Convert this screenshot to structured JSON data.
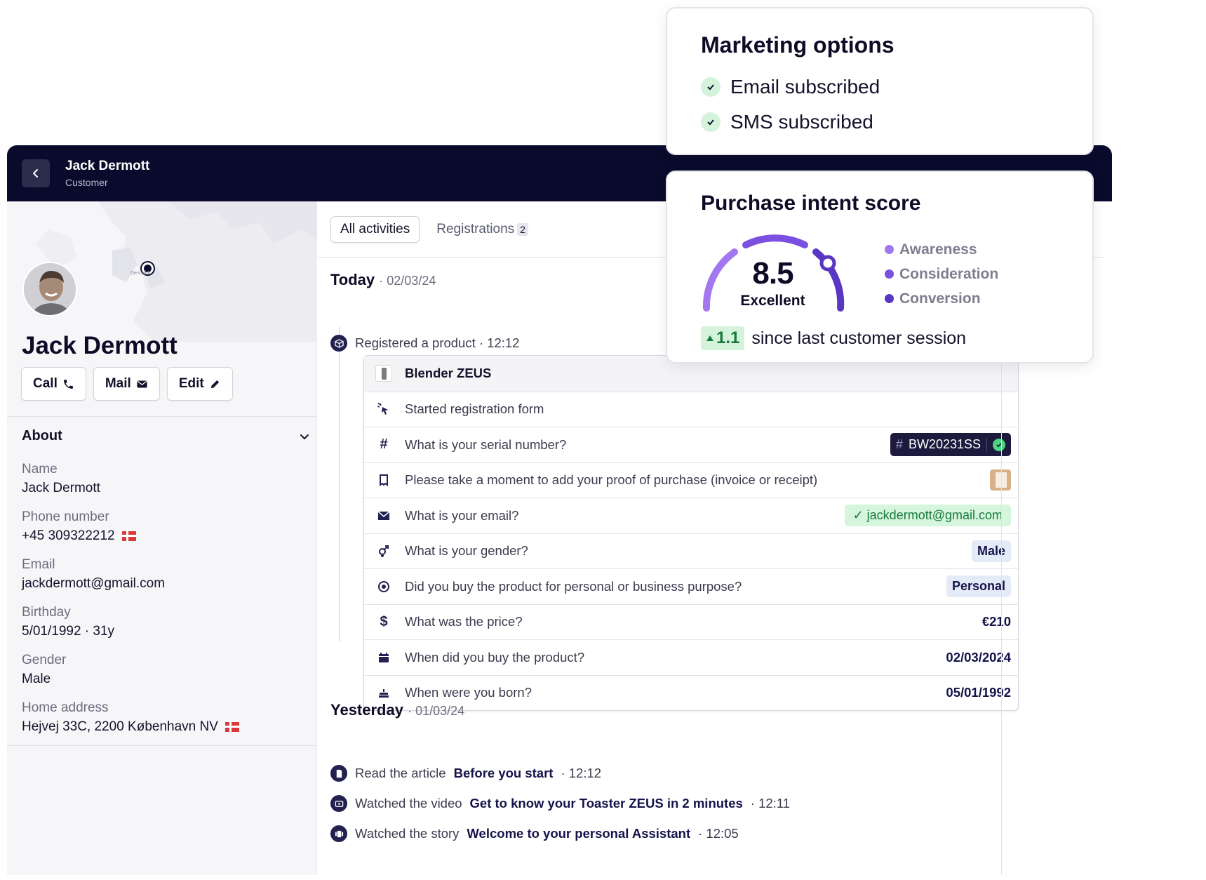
{
  "header": {
    "title": "Jack Dermott",
    "subtitle": "Customer"
  },
  "map": {
    "label": "Denmark"
  },
  "profile": {
    "name": "Jack Dermott",
    "actions": [
      {
        "label": "Call",
        "icon": "phone-icon"
      },
      {
        "label": "Mail",
        "icon": "mail-icon"
      },
      {
        "label": "Edit",
        "icon": "pencil-icon"
      }
    ]
  },
  "about": {
    "title": "About",
    "fields": [
      {
        "label": "Name",
        "value": "Jack Dermott"
      },
      {
        "label": "Phone number",
        "value": "+45 309322212"
      },
      {
        "label": "Email",
        "value": "jackdermott@gmail.com"
      },
      {
        "label": "Birthday",
        "value": "5/01/1992 · 31y"
      },
      {
        "label": "Gender",
        "value": "Male"
      },
      {
        "label": "Home address",
        "value": "Hejvej 33C, 2200 København NV"
      }
    ]
  },
  "tabs": [
    {
      "label": "All activities"
    },
    {
      "label": "Registrations",
      "count": "2"
    }
  ],
  "today": {
    "label": "Today",
    "date": "· 02/03/24",
    "event": "Registered a product · 12:12",
    "rows": [
      {
        "icon": "product-image",
        "text": "Blender ZEUS",
        "value": ""
      },
      {
        "icon": "cursor-click-icon",
        "text": "Started registration form",
        "value": ""
      },
      {
        "icon": "hash-icon",
        "text": "What is your serial number?",
        "value": "BW20231SS"
      },
      {
        "icon": "receipt-icon",
        "text": "Please take a moment to add your proof of purchase (invoice or receipt)",
        "value": ""
      },
      {
        "icon": "envelope-icon",
        "text": "What is your email?",
        "value": "jackdermott@gmail.com"
      },
      {
        "icon": "gender-icon",
        "text": "What is your gender?",
        "value": "Male"
      },
      {
        "icon": "target-icon",
        "text": "Did you buy the product for personal or business purpose?",
        "value": "Personal"
      },
      {
        "icon": "dollar-icon",
        "text": "What was the price?",
        "value": "€210"
      },
      {
        "icon": "calendar-icon",
        "text": "When did you buy the product?",
        "value": "02/03/2024"
      },
      {
        "icon": "cake-icon",
        "text": "When were you born?",
        "value": "05/01/1992"
      }
    ]
  },
  "yesterday": {
    "label": "Yesterday",
    "date": "· 01/03/24",
    "events": [
      {
        "prefix": "Read the article",
        "link": "Before you start",
        "time": "· 12:12"
      },
      {
        "prefix": "Watched the video",
        "link": "Get to know your Toaster ZEUS in 2 minutes",
        "time": "· 12:11"
      },
      {
        "prefix": "Watched the story",
        "link": "Welcome to your personal Assistant",
        "time": "· 12:05"
      }
    ]
  },
  "marketing": {
    "title": "Marketing options",
    "items": [
      "Email subscribed",
      "SMS subscribed"
    ]
  },
  "purchase_intent": {
    "title": "Purchase intent score",
    "score": "8.5",
    "rating": "Excellent",
    "stages": [
      {
        "label": "Awareness",
        "color": "#a277f0"
      },
      {
        "label": "Consideration",
        "color": "#7b4fe0"
      },
      {
        "label": "Conversion",
        "color": "#5a37c2"
      }
    ],
    "delta": "1.1",
    "delta_text": "since last customer session"
  },
  "colors": {
    "navy": "#0a0b2c",
    "success_bg": "#d5f3db",
    "success_fg": "#177a3b",
    "purple": "#6b45d8"
  }
}
